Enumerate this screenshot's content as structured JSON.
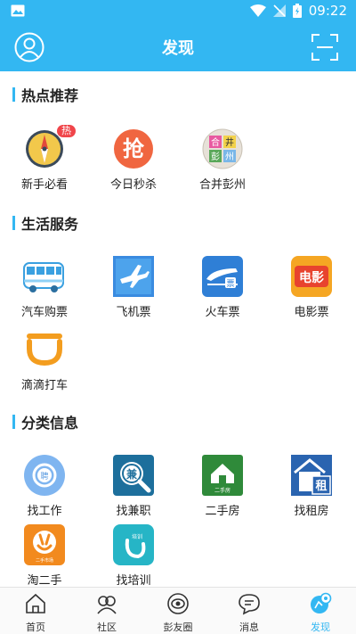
{
  "status_bar": {
    "time": "09:22"
  },
  "header": {
    "title": "发现"
  },
  "sections": {
    "hot": {
      "title": "热点推荐",
      "items": [
        {
          "label": "新手必看",
          "badge": "热",
          "icon": "compass-icon"
        },
        {
          "label": "今日秒杀",
          "icon": "flash-sale-icon",
          "glyph": "抢"
        },
        {
          "label": "合并彭州",
          "icon": "merge-pengzhou-icon",
          "glyphs": [
            "合",
            "井",
            "彭",
            "州"
          ]
        }
      ]
    },
    "life": {
      "title": "生活服务",
      "items": [
        {
          "label": "汽车购票",
          "icon": "bus-icon"
        },
        {
          "label": "飞机票",
          "icon": "airplane-icon"
        },
        {
          "label": "火车票",
          "icon": "train-icon",
          "glyph": "票"
        },
        {
          "label": "电影票",
          "icon": "movie-icon",
          "glyph": "电影"
        },
        {
          "label": "滴滴打车",
          "icon": "didi-icon"
        }
      ]
    },
    "classified": {
      "title": "分类信息",
      "items": [
        {
          "label": "找工作",
          "icon": "job-icon",
          "glyph": "聘"
        },
        {
          "label": "找兼职",
          "icon": "part-time-icon",
          "glyph": "兼"
        },
        {
          "label": "二手房",
          "icon": "second-hand-house-icon",
          "glyph": "二手房"
        },
        {
          "label": "找租房",
          "icon": "rent-house-icon",
          "glyph": "租"
        },
        {
          "label": "淘二手",
          "icon": "second-hand-goods-icon",
          "glyph": "二手市场"
        },
        {
          "label": "找培训",
          "icon": "training-icon",
          "glyph": "培训"
        }
      ]
    }
  },
  "tabs": [
    {
      "label": "首页",
      "icon": "home-icon"
    },
    {
      "label": "社区",
      "icon": "community-icon"
    },
    {
      "label": "彭友圈",
      "icon": "friends-circle-icon"
    },
    {
      "label": "消息",
      "icon": "message-icon"
    },
    {
      "label": "发现",
      "icon": "discover-icon",
      "active": true
    }
  ],
  "colors": {
    "primary": "#33b7f2",
    "badge": "#f0454a"
  }
}
